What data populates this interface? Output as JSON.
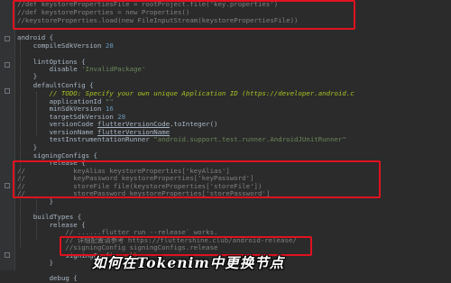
{
  "editor": {
    "lines": [
      "//def keystorePropertiesFile = rootProject.file('key.properties')",
      "//def keystoreProperties = new Properties()",
      "//keystoreProperties.load(new FileInputStream(keystorePropertiesFile))",
      "",
      "android {",
      "    compileSdkVersion 28",
      "",
      "    lintOptions {",
      "        disable 'InvalidPackage'",
      "    }",
      "",
      "    defaultConfig {",
      "        // TODO: Specify your own unique Application ID (https://developer.android.c",
      "        applicationId \"\"",
      "        minSdkVersion 16",
      "        targetSdkVersion 28",
      "        versionCode flutterVersionCode.toInteger()",
      "        versionName flutterVersionName",
      "        testInstrumentationRunner \"android.support.test.runner.AndroidJUnitRunner\"",
      "    }",
      "",
      "    signingConfigs {",
      "        release {",
      "//            keyAlias keystoreProperties['keyAlias']",
      "//            keyPassword keystoreProperties['keyPassword']",
      "//            storeFile file(keystoreProperties['storeFile'])",
      "//            storePassword keystoreProperties['storePassword']",
      "        }",
      "",
      "    buildTypes {",
      "        release {",
      "            // ......flutter run --release` works.",
      "            // 详细配置请参考 https://fluttershine.club/android-release/",
      "            //signingConfig signingConfigs.release",
      "            signingConfig null",
      "        }",
      "",
      "        debug {"
    ]
  },
  "caption": "如何在Tokenim中更换节点",
  "colors": {
    "background": "#2b2b2b",
    "keyword": "#cc7832",
    "string": "#6a8759",
    "number": "#6897bb",
    "comment": "#808080",
    "highlight_box": "#e0121f"
  }
}
